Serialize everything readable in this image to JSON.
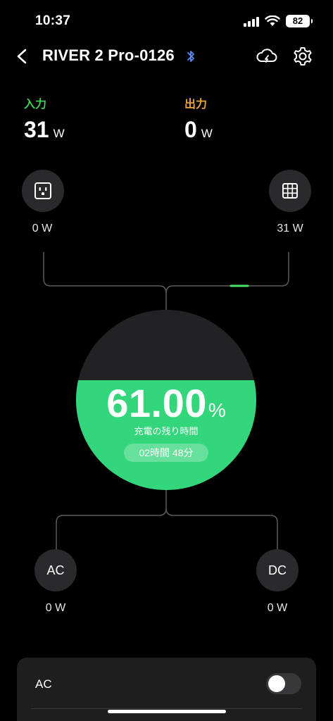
{
  "status_bar": {
    "time": "10:37",
    "battery": "82"
  },
  "header": {
    "title": "RIVER 2 Pro-0126"
  },
  "totals": {
    "input": {
      "label": "入力",
      "value": "31",
      "unit": "W"
    },
    "output": {
      "label": "出力",
      "value": "0",
      "unit": "W"
    }
  },
  "ports": {
    "ac_input": {
      "icon": "ac-outlet-icon",
      "watts": "0 W"
    },
    "solar_input": {
      "icon": "solar-panel-icon",
      "watts": "31 W"
    },
    "ac_output": {
      "label": "AC",
      "watts": "0 W"
    },
    "dc_output": {
      "label": "DC",
      "watts": "0 W"
    }
  },
  "battery": {
    "percent": "61.00",
    "unit": "%",
    "level": 0.61,
    "caption": "充電の残り時間",
    "remaining": "02時間 48分"
  },
  "ac_card": {
    "label": "AC",
    "switch_on": false
  },
  "colors": {
    "accent_green": "#33d67a",
    "input_green": "#3ecf5a",
    "output_orange": "#e8a33a"
  }
}
